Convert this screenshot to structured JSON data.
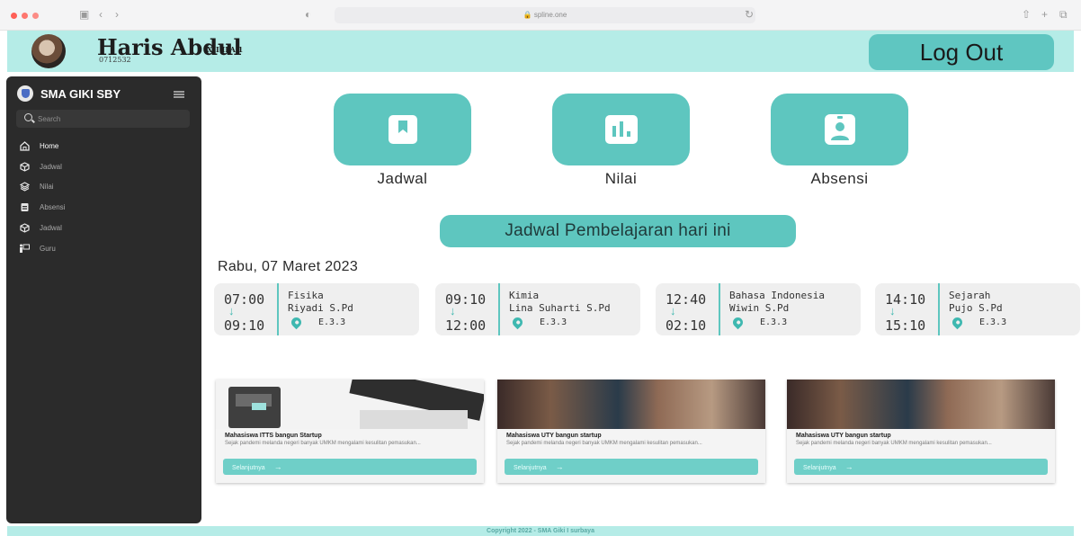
{
  "browser": {
    "url": "spline.one"
  },
  "header": {
    "user_name": "Haris Abdul",
    "user_class": "XII IPA 1",
    "user_nis": "0712532",
    "logout_label": "Log Out"
  },
  "sidebar": {
    "brand": "SMA GIKI SBY",
    "search_placeholder": "Search",
    "items": [
      {
        "label": "Home",
        "icon": "home-icon"
      },
      {
        "label": "Jadwal",
        "icon": "cube-icon"
      },
      {
        "label": "Nilai",
        "icon": "layers-icon"
      },
      {
        "label": "Absensi",
        "icon": "document-icon"
      },
      {
        "label": "Jadwal",
        "icon": "cube-icon"
      },
      {
        "label": "Guru",
        "icon": "teacher-icon"
      }
    ]
  },
  "tiles": [
    {
      "label": "Jadwal",
      "icon": "bookmark-icon"
    },
    {
      "label": "Nilai",
      "icon": "bar-chart-icon"
    },
    {
      "label": "Absensi",
      "icon": "id-badge-icon"
    }
  ],
  "schedule_title": "Jadwal Pembelajaran hari ini",
  "date": "Rabu, 07 Maret 2023",
  "schedule": [
    {
      "start": "07:00",
      "end": "09:10",
      "subject": "Fisika",
      "teacher": "Riyadi S.Pd",
      "room": "E.3.3"
    },
    {
      "start": "09:10",
      "end": "12:00",
      "subject": "Kimia",
      "teacher": "Lina Suharti S.Pd",
      "room": "E.3.3"
    },
    {
      "start": "12:40",
      "end": "02:10",
      "subject": "Bahasa Indonesia",
      "teacher": "Wiwin S.Pd",
      "room": "E.3.3"
    },
    {
      "start": "14:10",
      "end": "15:10",
      "subject": "Sejarah",
      "teacher": "Pujo S.Pd",
      "room": "E.3.3"
    }
  ],
  "news": [
    {
      "title": "Mahasiswa ITTS bangun Startup",
      "excerpt": "Sejak pandemi melanda negeri banyak UMKM mengalami kesulitan pemasukan...",
      "button": "Selanjutnya"
    },
    {
      "title": "Mahasiswa UTY bangun startup",
      "excerpt": "Sejak pandemi melanda negeri banyak UMKM mengalami kesulitan pemasukan...",
      "button": "Selanjutnya"
    },
    {
      "title": "Mahasiswa UTY bangun startup",
      "excerpt": "Sejak pandemi melanda negeri banyak UMKM mengalami kesulitan pemasukan...",
      "button": "Selanjutnya"
    }
  ],
  "footer": "Copyright 2022 - SMA Giki I surbaya",
  "colors": {
    "accent": "#5ec6bf",
    "header_bg": "#b5ece7",
    "sidebar_bg": "#2b2b2b"
  }
}
